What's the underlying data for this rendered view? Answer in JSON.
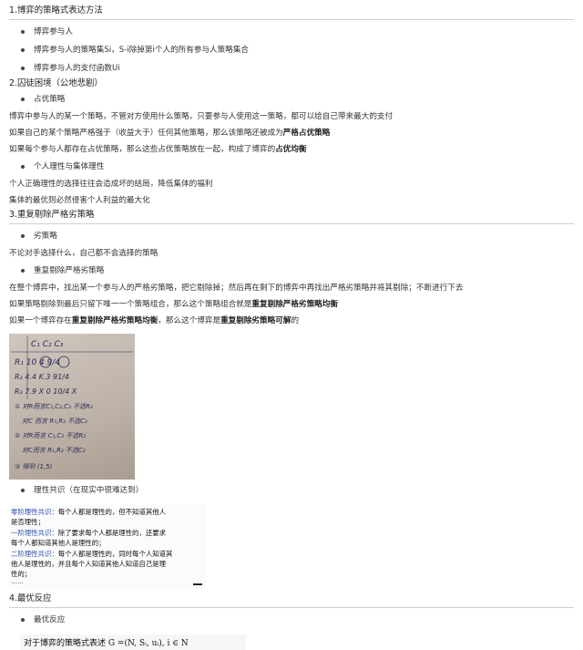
{
  "sections": [
    {
      "title": "1.博弈的策略式表达方法"
    },
    {
      "title": "2.囚徒困境（公地悲剧）"
    },
    {
      "title": "3.重复剔除严格劣策略"
    },
    {
      "title": "4.最优反应"
    }
  ],
  "s1_items": [
    "博弈参与人",
    "博弈参与人的策略集Si，S-i除掉第i个人的所有参与人策略集合",
    "博弈参与人的支付函数Ui"
  ],
  "s2": {
    "bullet1": "占优策略",
    "p1": "博弈中参与人的某一个策略，不管对方使用什么策略，只要参与人使用这一策略，都可以给自己带来最大的支付",
    "p2_pre": "如果自己的某个策略严格强于（收益大于）任何其他策略，那么该策略还被成为",
    "p2_bold": "严格占优策略",
    "p3_pre": "如果每个参与人都存在占优策略，那么这些占优策略放在一起，构成了博弈的",
    "p3_bold": "占优均衡",
    "bullet2": "个人理性与集体理性",
    "p4": "个人正确理性的选择往往会造成坏的结局，降低集体的福利",
    "p5": "集体的最优则必然侵害个人利益的最大化"
  },
  "s3": {
    "bullet1": "劣策略",
    "p1": "不论对手选择什么，自己都不会选择的策略",
    "bullet2": "重复剔除严格劣策略",
    "p2": "在整个博弈中，找出某一个参与人的严格劣策略，把它剔除掉；然后再在剩下的博弈中再找出严格劣策略并将其剔除；不断进行下去",
    "p3_pre": "如果策略剔除到最后只留下唯一一个策略组合，那么这个策略组合就是",
    "p3_bold": "重复剔除严格劣策略均衡",
    "p4_a": "如果一个博弈存在",
    "p4_b": "重复剔除严格劣策略均衡",
    "p4_c": "，那么这个博弈是",
    "p4_d": "重复剔除劣策略可解",
    "p4_e": "的",
    "bullet3": "理性共识（在现实中很难达到）",
    "def_lines": [
      {
        "tag": "零阶理性共识：",
        "text": "每个人都是理性的，但不知道其他人"
      },
      {
        "tag": "",
        "text": "是否理性；"
      },
      {
        "tag": "一阶理性共识：",
        "text": "除了要求每个人都是理性的，还要求"
      },
      {
        "tag": "",
        "text": "每个人都知道其他人是理性的；"
      },
      {
        "tag": "二阶理性共识：",
        "text": "每个人都是理性的，同时每个人知道其"
      },
      {
        "tag": "",
        "text": "他人是理性的，并且每个人知道其他人知道自己是理"
      },
      {
        "tag": "",
        "text": "性的；"
      }
    ],
    "def_dots": "……"
  },
  "s4": {
    "bullet1": "最优反应",
    "formula": "对于博弈的策略式表述 G =(N, Sᵢ, uᵢ), i ∈ N"
  },
  "photo": {
    "row_cols": "C₁   C₂   C₃",
    "r1": "R₁   10   4   9/4",
    "r2": "R₂   4.4   K.3   91/4",
    "r3": "R₃   7.9  X  0   10/4  X",
    "n1": "① 对R而言C₁,C₂,C₃ 不选R₃",
    "n2": "对C 而言 R₁,R₂ 不选C₃",
    "n3": "② 对R而言 C₁,C₂ 不选R₂",
    "n4": "对C而言 R₁,R₂ 不选C₂",
    "n5": "③ 得到 (1,5)"
  },
  "colors": {
    "text": "#333333",
    "rule": "#cfcfcf",
    "def_tag": "#2f4fb0"
  }
}
